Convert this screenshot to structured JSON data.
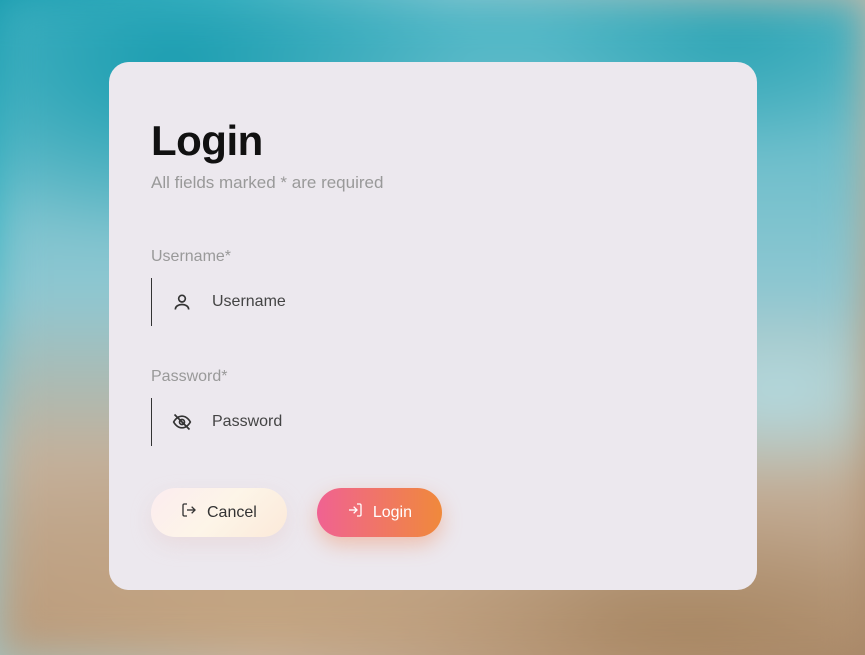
{
  "header": {
    "title": "Login",
    "subtitle": "All fields marked * are required"
  },
  "form": {
    "username": {
      "label": "Username*",
      "placeholder": "Username"
    },
    "password": {
      "label": "Password*",
      "placeholder": "Password"
    }
  },
  "buttons": {
    "cancel": "Cancel",
    "login": "Login"
  }
}
